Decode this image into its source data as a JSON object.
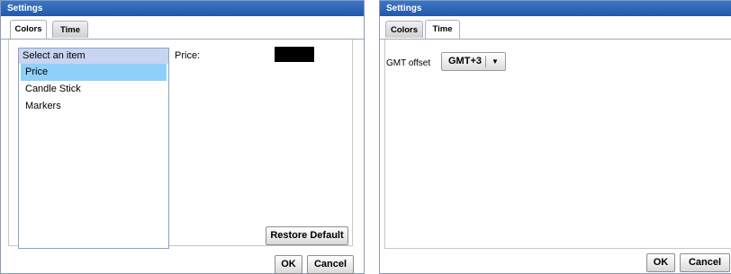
{
  "dialog_left": {
    "title": "Settings",
    "tabs": [
      {
        "label": "Colors",
        "active": true
      },
      {
        "label": "Time",
        "active": false
      }
    ],
    "list": {
      "header": "Select an item",
      "items": [
        {
          "label": "Price",
          "selected": true
        },
        {
          "label": "Candle Stick",
          "selected": false
        },
        {
          "label": "Markers",
          "selected": false
        }
      ]
    },
    "price_label": "Price:",
    "price_color": "#000000",
    "restore_label": "Restore Default",
    "ok_label": "OK",
    "cancel_label": "Cancel"
  },
  "dialog_right": {
    "title": "Settings",
    "tabs": [
      {
        "label": "Colors",
        "active": false
      },
      {
        "label": "Time",
        "active": true
      }
    ],
    "gmt_label": "GMT offset",
    "gmt_value": "GMT+3",
    "dropdown_icon": "caret-down-icon",
    "ok_label": "OK",
    "cancel_label": "Cancel"
  }
}
